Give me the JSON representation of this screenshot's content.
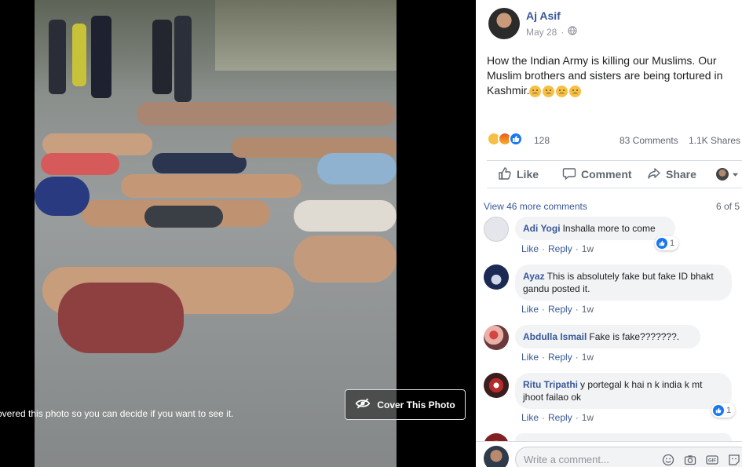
{
  "viewer": {
    "caption": "overed this photo so you can decide if you want to see it.",
    "cover_button": "Cover This Photo"
  },
  "post": {
    "author": "Aj Asif",
    "date": "May 28",
    "privacy_icon": "globe-icon",
    "text": "How the Indian Army is killing our Muslims. Our Muslim brothers and sisters are being tortured in Kashmir.",
    "text_emojis": [
      "sad-face",
      "sad-face",
      "sad-face",
      "sad-face"
    ],
    "reaction_icons": [
      "sad-reaction-icon",
      "angry-reaction-icon",
      "like-reaction-icon"
    ],
    "reaction_count": "128",
    "comments_count": "83 Comments",
    "shares_count": "1.1K Shares"
  },
  "actions": {
    "like": "Like",
    "comment": "Comment",
    "share": "Share"
  },
  "comments_header": {
    "view_more": "View 46 more comments",
    "page_count": "6 of 5"
  },
  "comments": [
    {
      "name": "Adi Yogi",
      "text": "Inshalla more to come",
      "like": "Like",
      "reply": "Reply",
      "time": "1w",
      "likes": "1"
    },
    {
      "name": "Ayaz",
      "text": "This is absolutely fake but fake ID bhakt gandu posted it.",
      "like": "Like",
      "reply": "Reply",
      "time": "1w"
    },
    {
      "name": "Abdulla Ismail",
      "text": "Fake is fake???????.",
      "like": "Like",
      "reply": "Reply",
      "time": "1w"
    },
    {
      "name": "Ritu Tripathi",
      "text": "y portegal k hai n k india k mt jhoot failao ok",
      "like": "Like",
      "reply": "Reply",
      "time": "1w",
      "likes": "1"
    }
  ],
  "composer": {
    "placeholder": "Write a comment..."
  },
  "colors": {
    "link": "#385898",
    "like_blue": "#1877f2",
    "bubble": "#f2f3f5"
  }
}
